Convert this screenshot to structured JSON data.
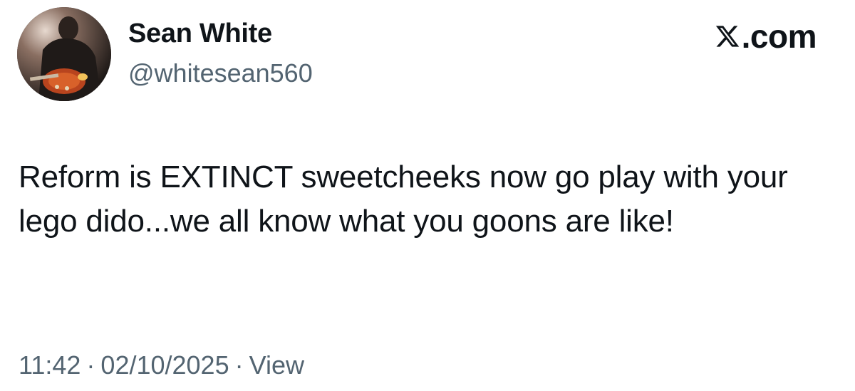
{
  "author": {
    "display_name": "Sean White",
    "handle": "@whitesean560",
    "avatar_icon": "profile-photo-person-with-guitar"
  },
  "brand": {
    "suffix": ".com",
    "icon": "x-logo-icon"
  },
  "tweet": {
    "text": "Reform is EXTINCT sweetcheeks now go play with your lego dido...we all know what you goons are like!"
  },
  "meta": {
    "time": "11:42",
    "separator": "·",
    "date": "02/10/2025",
    "view_label": "View"
  },
  "colors": {
    "text_primary": "#0f1419",
    "text_secondary": "#536471",
    "background": "#ffffff"
  }
}
